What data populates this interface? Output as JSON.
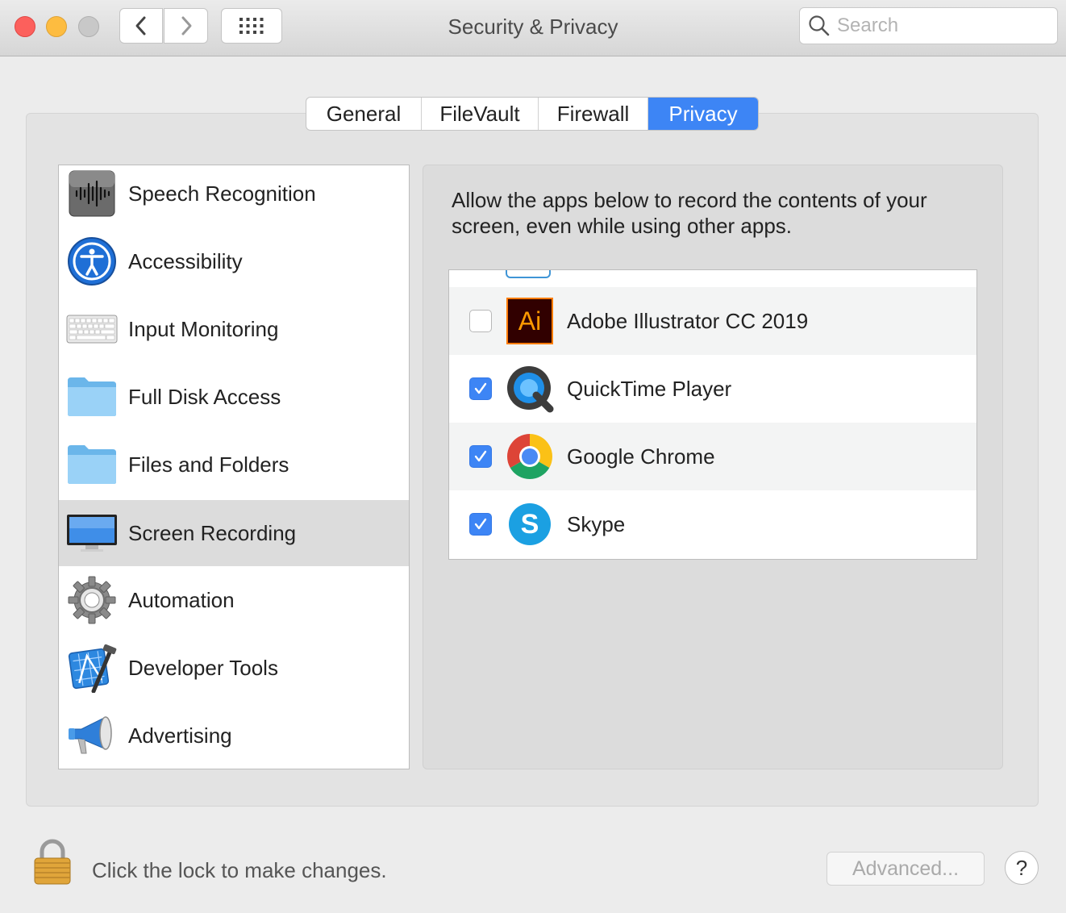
{
  "window": {
    "title": "Security & Privacy",
    "search_placeholder": "Search"
  },
  "icons": {
    "back": "chevron-left-icon",
    "forward": "chevron-right-icon",
    "grid": "grid-icon",
    "search": "search-icon"
  },
  "tabs": [
    {
      "label": "General",
      "active": false
    },
    {
      "label": "FileVault",
      "active": false
    },
    {
      "label": "Firewall",
      "active": false
    },
    {
      "label": "Privacy",
      "active": true
    }
  ],
  "categories": [
    {
      "label": "Speech Recognition",
      "icon": "waveform-icon",
      "selected": false
    },
    {
      "label": "Accessibility",
      "icon": "accessibility-icon",
      "selected": false
    },
    {
      "label": "Input Monitoring",
      "icon": "keyboard-icon",
      "selected": false
    },
    {
      "label": "Full Disk Access",
      "icon": "folder-icon",
      "selected": false
    },
    {
      "label": "Files and Folders",
      "icon": "folder-icon",
      "selected": false
    },
    {
      "label": "Screen Recording",
      "icon": "display-icon",
      "selected": true
    },
    {
      "label": "Automation",
      "icon": "gear-icon",
      "selected": false
    },
    {
      "label": "Developer Tools",
      "icon": "developer-tools-icon",
      "selected": false
    },
    {
      "label": "Advertising",
      "icon": "megaphone-icon",
      "selected": false
    }
  ],
  "description": "Allow the apps below to record the contents of your screen, even while using other apps.",
  "apps": [
    {
      "label": "Adobe Illustrator CC 2019",
      "icon": "illustrator-icon",
      "icon_text": "Ai",
      "checked": false
    },
    {
      "label": "QuickTime Player",
      "icon": "quicktime-icon",
      "checked": true
    },
    {
      "label": "Google Chrome",
      "icon": "chrome-icon",
      "checked": true
    },
    {
      "label": "Skype",
      "icon": "skype-icon",
      "icon_text": "S",
      "checked": true
    }
  ],
  "footer": {
    "lock_text": "Click the lock to make changes.",
    "advanced_label": "Advanced...",
    "help_label": "?"
  },
  "colors": {
    "accent": "#3d85f5",
    "close": "#fc605c",
    "minimize": "#fdbc40"
  }
}
